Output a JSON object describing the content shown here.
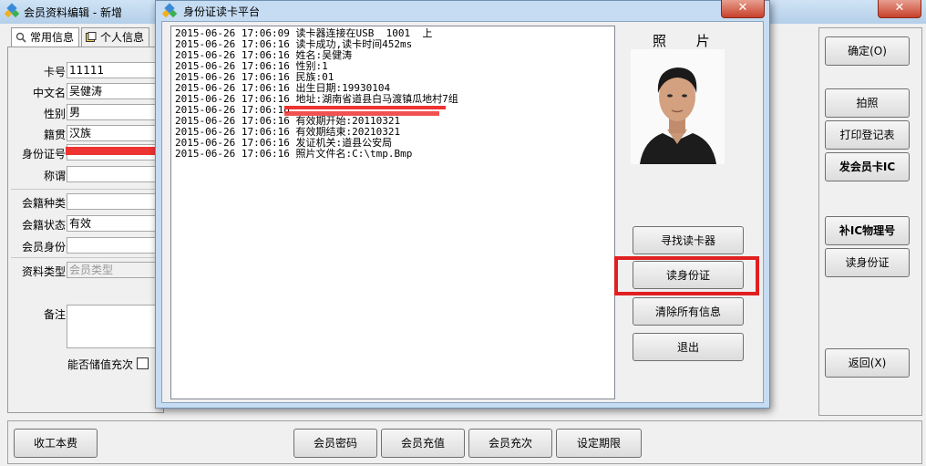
{
  "main_window": {
    "title": "会员资料编辑 - 新增",
    "close_glyph": "✕",
    "tabs": [
      {
        "label": "常用信息",
        "icon": "search-user-icon"
      },
      {
        "label": "个人信息",
        "icon": "person-card-icon"
      }
    ],
    "form": {
      "card_no": {
        "label": "卡号",
        "value": "11111"
      },
      "chinese_name": {
        "label": "中文名",
        "value": "吴健涛"
      },
      "gender": {
        "label": "性别",
        "value": "男"
      },
      "native": {
        "label": "籍贯",
        "value": "汉族"
      },
      "id_no": {
        "label": "身份证号",
        "value": ""
      },
      "title": {
        "label": "称谓",
        "value": ""
      },
      "membership_type": {
        "label": "会籍种类",
        "value": ""
      },
      "membership_status": {
        "label": "会籍状态",
        "value": "有效"
      },
      "member_identity": {
        "label": "会员身份",
        "value": ""
      },
      "profile_type": {
        "label": "资料类型",
        "value": "会员类型"
      },
      "remark": {
        "label": "备注",
        "value": ""
      },
      "stored_value": {
        "label": "能否储值充次"
      }
    },
    "right_buttons": {
      "confirm": "确定(O)",
      "photo": "拍照",
      "print_form": "打印登记表",
      "issue_ic": "发会员卡IC",
      "supplement_ic": "补IC物理号",
      "read_id": "读身份证",
      "back": "返回(X)"
    },
    "bottom_buttons": {
      "labor_fee": "收工本费",
      "member_password": "会员密码",
      "member_recharge": "会员充值",
      "member_recharge_times": "会员充次",
      "set_period": "设定期限"
    }
  },
  "dialog": {
    "title": "身份证读卡平台",
    "close_glyph": "✕",
    "photo_label": "照 片",
    "log": [
      {
        "time": "2015-06-26 17:06:09",
        "msg": "读卡器连接在USB  1001  上"
      },
      {
        "time": "2015-06-26 17:06:16",
        "msg": "读卡成功,读卡时间452ms"
      },
      {
        "time": "2015-06-26 17:06:16",
        "msg": "姓名:吴健涛"
      },
      {
        "time": "2015-06-26 17:06:16",
        "msg": "性别:1"
      },
      {
        "time": "2015-06-26 17:06:16",
        "msg": "民族:01"
      },
      {
        "time": "2015-06-26 17:06:16",
        "msg": "出生日期:19930104"
      },
      {
        "time": "2015-06-26 17:06:16",
        "msg": "地址:湖南省道县白马渡镇瓜地村7组"
      },
      {
        "time": "2015-06-26 17:06:16",
        "msg": ""
      },
      {
        "time": "2015-06-26 17:06:16",
        "msg": "有效期开始:20110321"
      },
      {
        "time": "2015-06-26 17:06:16",
        "msg": "有效期结束:20210321"
      },
      {
        "time": "2015-06-26 17:06:16",
        "msg": "发证机关:道县公安局"
      },
      {
        "time": "2015-06-26 17:06:16",
        "msg": "照片文件名:C:\\tmp.Bmp"
      }
    ],
    "buttons": {
      "find_reader": "寻找读卡器",
      "read_id": "读身份证",
      "clear_all": "清除所有信息",
      "exit": "退出"
    }
  },
  "colors": {
    "highlight_red": "#e02020",
    "redaction_red": "#ee3333",
    "dialog_frame": "#c5dcf2"
  }
}
